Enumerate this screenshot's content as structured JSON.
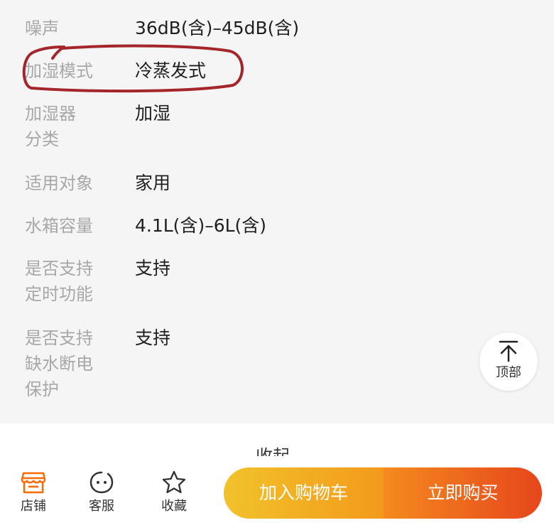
{
  "specs": [
    {
      "label": "噪声",
      "value": "36dB(含)–45dB(含)"
    },
    {
      "label": "加湿模式",
      "value": "冷蒸发式"
    },
    {
      "label": "加湿器分类",
      "value": "加湿"
    },
    {
      "label": "适用对象",
      "value": "家用"
    },
    {
      "label": "水箱容量",
      "value": "4.1L(含)–6L(含)"
    },
    {
      "label": "是否支持定时功能",
      "value": "支持"
    },
    {
      "label": "是否支持缺水断电保护",
      "value": "支持"
    }
  ],
  "spec_label_lines": {
    "row0": [
      "噪声"
    ],
    "row1": [
      "加湿模式"
    ],
    "row2": [
      "加湿器",
      "分类"
    ],
    "row3": [
      "适用对象"
    ],
    "row4": [
      "水箱容量"
    ],
    "row5": [
      "是否支持",
      "定时功能"
    ],
    "row6": [
      "是否支持",
      "缺水断电",
      "保护"
    ]
  },
  "back_to_top": {
    "label": "顶部",
    "icon": "arrow-up-to-top-icon"
  },
  "collapse_label": "收起",
  "bottom_nav": [
    {
      "label": "店铺",
      "icon": "store-icon",
      "color": "#ff6a00"
    },
    {
      "label": "客服",
      "icon": "customer-service-face-icon",
      "color": "#333333"
    },
    {
      "label": "收藏",
      "icon": "star-icon",
      "color": "#333333"
    }
  ],
  "actions": {
    "add_to_cart": "加入购物车",
    "buy_now": "立即购买"
  },
  "colors": {
    "annotation": "#a5262a",
    "accent": "#ff6a00",
    "cart_gradient": [
      "#f2c22a",
      "#f39a1c"
    ],
    "buy_gradient": [
      "#f58a1e",
      "#e6461c"
    ]
  }
}
